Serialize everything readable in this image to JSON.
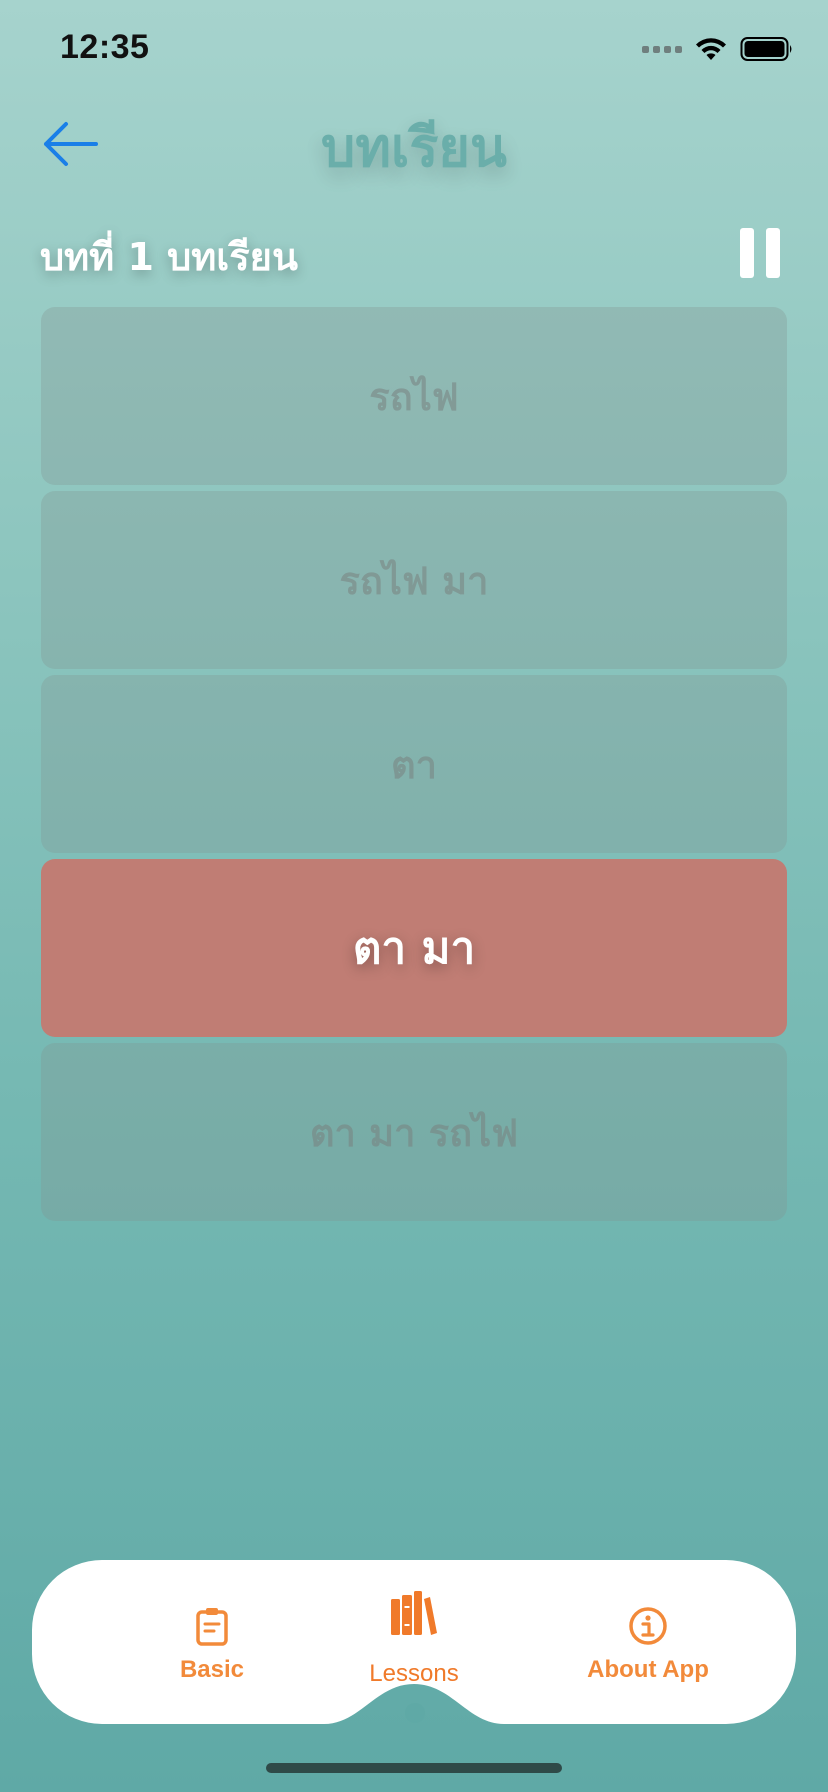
{
  "status_bar": {
    "time": "12:35"
  },
  "header": {
    "title": "บทเรียน"
  },
  "lesson": {
    "heading": "บทที่ 1  บทเรียน"
  },
  "phrases": [
    {
      "text": "รถไฟ",
      "active": false
    },
    {
      "text": "รถไฟ มา",
      "active": false
    },
    {
      "text": "ตา",
      "active": false
    },
    {
      "text": "ตา มา",
      "active": true
    },
    {
      "text": "ตา มา รถไฟ",
      "active": false
    }
  ],
  "tabs": [
    {
      "label": "Basic",
      "icon": "clipboard-icon"
    },
    {
      "label": "Lessons",
      "icon": "books-icon",
      "selected": true
    },
    {
      "label": "About App",
      "icon": "info-icon"
    }
  ],
  "colors": {
    "accent": "#f28a3a",
    "active_card": "#c07d74",
    "back_arrow": "#1a7fe8"
  }
}
